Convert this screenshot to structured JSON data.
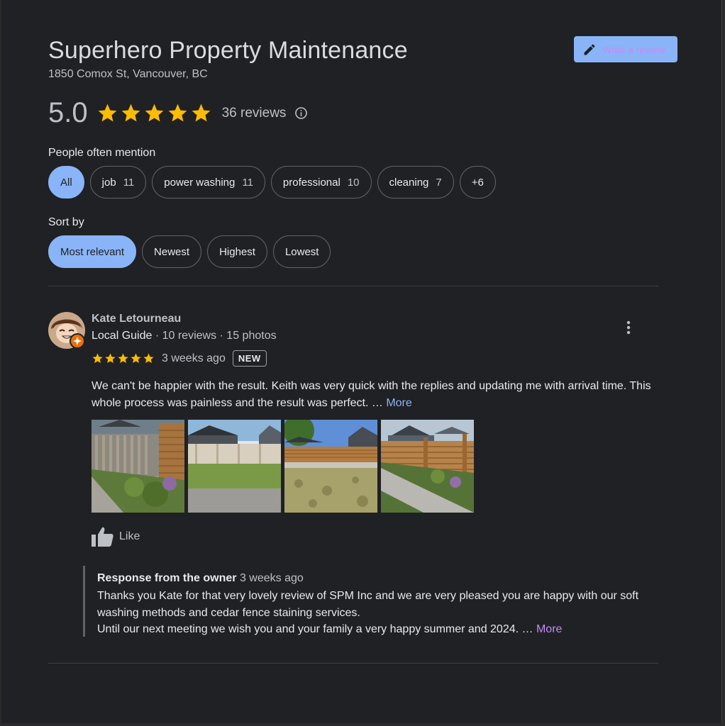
{
  "business": {
    "name": "Superhero Property Maintenance",
    "address": "1850 Comox St, Vancouver, BC",
    "write_review_label": "Write a review"
  },
  "rating": {
    "score": "5.0",
    "stars": 5,
    "reviews_label": "36 reviews"
  },
  "mentions": {
    "heading": "People often mention",
    "chips": [
      {
        "label": "All",
        "count": ""
      },
      {
        "label": "job",
        "count": "11"
      },
      {
        "label": "power washing",
        "count": "11"
      },
      {
        "label": "professional",
        "count": "10"
      },
      {
        "label": "cleaning",
        "count": "7"
      },
      {
        "label": "+6",
        "count": ""
      }
    ],
    "selected": "All"
  },
  "sort": {
    "heading": "Sort by",
    "options": [
      "Most relevant",
      "Newest",
      "Highest",
      "Lowest"
    ],
    "selected": "Most relevant"
  },
  "review": {
    "author": "Kate Letourneau",
    "author_meta_guide": "Local Guide",
    "author_meta_rest": " · 10 reviews · 15 photos",
    "stars": 5,
    "date": "3 weeks ago",
    "badge": "NEW",
    "text": "We can't be happier with the result. Keith was very quick with the replies and updating me with arrival time. This whole process was painless and the result was perfect. … ",
    "more_label": "More",
    "photo_count": 4,
    "like_label": "Like"
  },
  "owner_response": {
    "heading": "Response from the owner",
    "date": "3 weeks ago",
    "line1": "Thanks you Kate for that very lovely review of SPM Inc and we are very pleased you are happy with our soft washing methods and cedar fence staining services.",
    "line2": "Until our next meeting we wish you and your family a very happy summer and 2024. … ",
    "more_label": "More"
  },
  "colors": {
    "background": "#202124",
    "accent": "#8ab4f8",
    "star": "#fbbc04",
    "link_visited": "#c58af9"
  }
}
